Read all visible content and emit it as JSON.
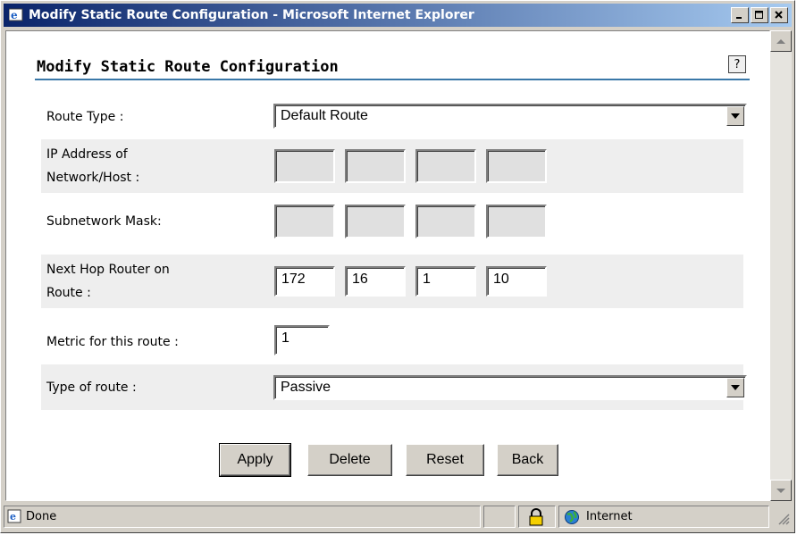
{
  "window": {
    "title": "Modify Static Route Configuration - Microsoft Internet Explorer",
    "controls": {
      "minimize": "_",
      "maximize": "□",
      "close": "×"
    }
  },
  "page": {
    "heading": "Modify Static Route Configuration",
    "help_label": "?"
  },
  "form": {
    "route_type": {
      "label": "Route Type :",
      "value": "Default Route"
    },
    "ip_address": {
      "label_line1": "IP Address of",
      "label_line2": "Network/Host :",
      "octets": [
        "",
        "",
        "",
        ""
      ]
    },
    "subnet_mask": {
      "label": "Subnetwork Mask:",
      "octets": [
        "",
        "",
        "",
        ""
      ]
    },
    "next_hop": {
      "label_line1": "Next Hop Router on",
      "label_line2": "Route :",
      "octets": [
        "172",
        "16",
        "1",
        "10"
      ]
    },
    "metric": {
      "label": "Metric for this route :",
      "value": "1"
    },
    "type_of_route": {
      "label": "Type of route :",
      "value": "Passive"
    }
  },
  "buttons": {
    "apply": "Apply",
    "delete": "Delete",
    "reset": "Reset",
    "back": "Back"
  },
  "statusbar": {
    "status": "Done",
    "zone": "Internet"
  },
  "colors": {
    "titlebar_start": "#0a246a",
    "titlebar_end": "#a6caf0",
    "rule": "#3a78a8",
    "row_shade": "#eeeeee"
  }
}
